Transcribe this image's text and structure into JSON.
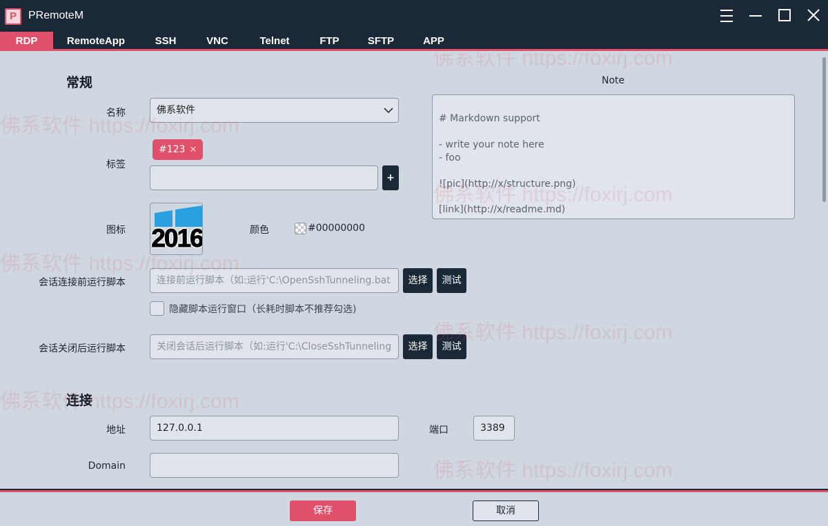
{
  "window": {
    "logo_letter": "P",
    "title": "PRemoteM",
    "controls": [
      "menu-icon",
      "minimize-icon",
      "maximize-icon",
      "close-icon"
    ]
  },
  "tabs": [
    {
      "label": "RDP",
      "active": true
    },
    {
      "label": "RemoteApp",
      "active": false
    },
    {
      "label": "SSH",
      "active": false
    },
    {
      "label": "VNC",
      "active": false
    },
    {
      "label": "Telnet",
      "active": false
    },
    {
      "label": "FTP",
      "active": false
    },
    {
      "label": "SFTP",
      "active": false
    },
    {
      "label": "APP",
      "active": false
    }
  ],
  "general": {
    "section_title": "常规",
    "name_label": "名称",
    "name_value": "佛系软件",
    "tags_label": "标签",
    "tag": "#123",
    "tag_input_value": "",
    "add_tag": "+",
    "icon_label": "图标",
    "icon_text": "2016",
    "color_label": "颜色",
    "color_value": "#00000000",
    "pre_script_label": "会话连接前运行脚本",
    "pre_script_placeholder": "连接前运行脚本（如:运行'C:\\OpenSshTunneling.bat",
    "select_label": "选择",
    "test_label": "测试",
    "hide_window_label": "隐藏脚本运行窗口（长耗时脚本不推荐勾选)",
    "hide_window_checked": false,
    "post_script_label": "会话关闭后运行脚本",
    "post_script_placeholder": "关闭会话后运行脚本（如:运行'C:\\CloseSshTunneling"
  },
  "note": {
    "title": "Note",
    "lines": [
      "# Markdown support",
      "",
      "- write your note here",
      "- foo",
      "",
      "![pic](http://x/structure.png)",
      "",
      "[link](http://x/readme.md)"
    ]
  },
  "connection": {
    "section_title": "连接",
    "address_label": "地址",
    "address_value": "127.0.0.1",
    "port_label": "端口",
    "port_value": "3389",
    "domain_label": "Domain",
    "domain_value": ""
  },
  "footer": {
    "save": "保存",
    "cancel": "取消"
  },
  "watermark": "佛系软件 https://foxirj.com",
  "colors": {
    "accent": "#e0506a",
    "titlebar": "#1b2838",
    "background": "#cfd8e0",
    "tag_bg": "#e0506a"
  }
}
